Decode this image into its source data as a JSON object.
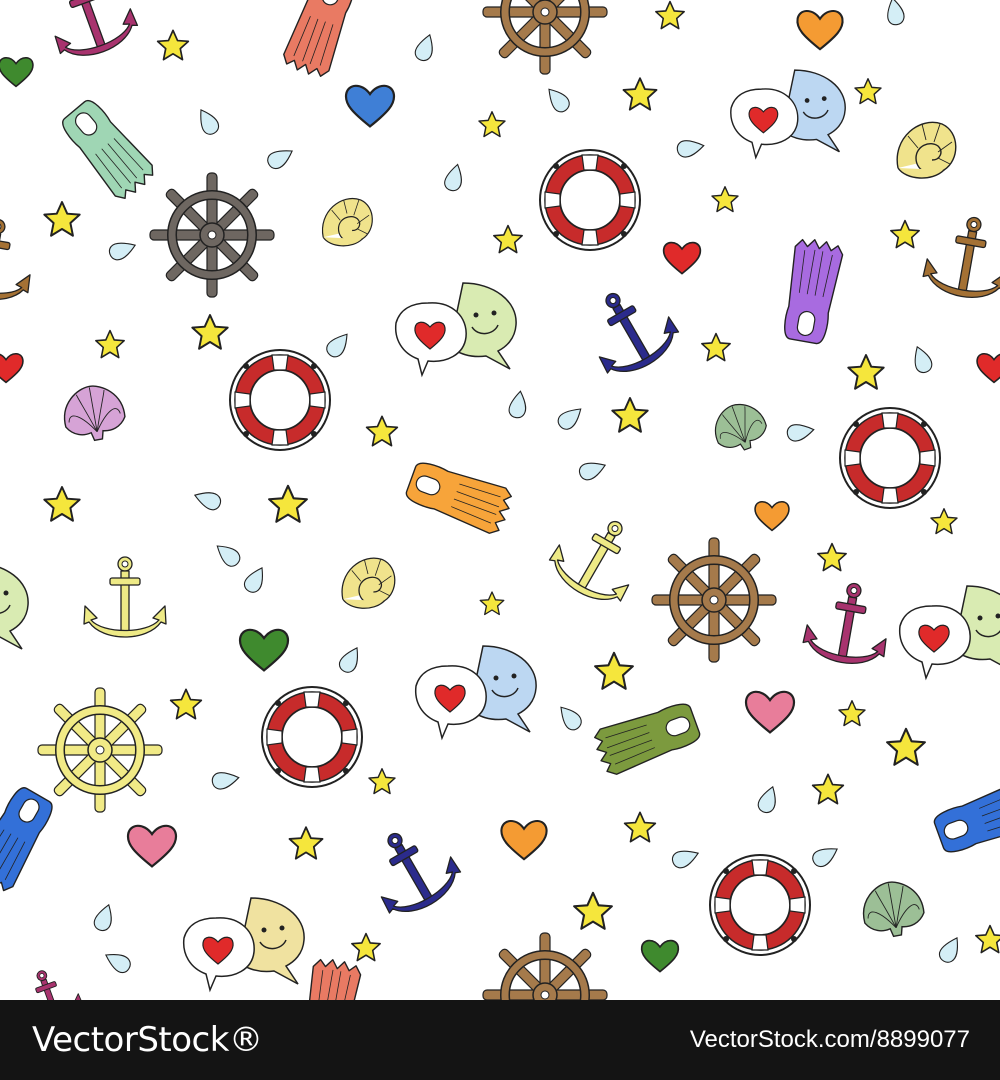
{
  "pattern": {
    "outline_color": "#222222",
    "colors": {
      "star": "#f5e63c",
      "drop": "#d4eef6",
      "lifebuoy_red": "#c72b2b",
      "anchor_magenta": "#a8336e",
      "anchor_brown": "#a47134",
      "anchor_navy": "#2b2b8c",
      "anchor_yellow": "#eeea86",
      "wheel_brown": "#a57a4b",
      "wheel_gray": "#6e6761",
      "wheel_yellow": "#f1ea86",
      "fin_coral": "#e97a63",
      "fin_mint": "#9fd6b4",
      "fin_purple": "#a86be0",
      "fin_orange": "#f7a43a",
      "fin_olive": "#7c9a3e",
      "fin_blue": "#3370d8",
      "heart_green": "#3f8a2e",
      "heart_blue": "#3f7fd6",
      "heart_orange": "#f49b33",
      "heart_red": "#e02a2a",
      "heart_pink": "#e87d9a",
      "shell_yellow": "#f0e38c",
      "shell_pink": "#d6a3d6",
      "shell_green": "#9cbf96",
      "bubble_blue": "#bcd7f2",
      "bubble_green": "#d9ebb2",
      "bubble_yellow": "#f0e2a0"
    }
  },
  "footer": {
    "logo_text": "VectorStock®",
    "stock_id": "VectorStock.com/8899077",
    "background": "#141414",
    "text_color": "#ffffff"
  }
}
